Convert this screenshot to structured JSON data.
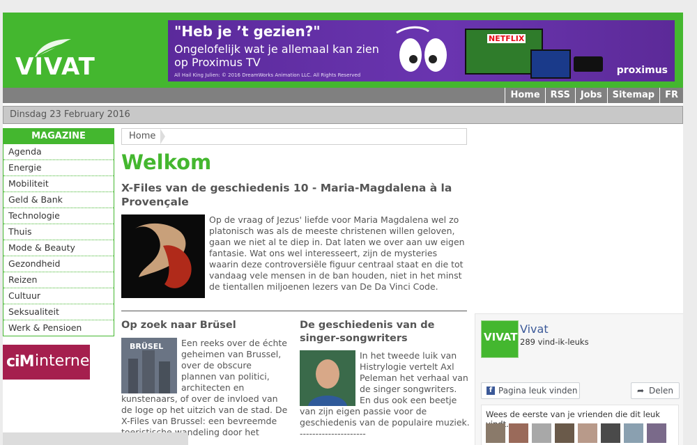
{
  "logo": {
    "text": "VIVAT"
  },
  "banner": {
    "headline": "\"Heb je ’t gezien?\"",
    "line1": "Ongelofelijk wat je allemaal kan zien",
    "line2": "op Proximus TV",
    "credit": "All Hail King Julien: © 2016 DreamWorks Animation LLC. All Rights Reserved",
    "netflix": "NETFLIX",
    "brand": "proximus"
  },
  "nav": {
    "items": [
      "Home",
      "RSS",
      "Jobs",
      "Sitemap",
      "FR"
    ]
  },
  "date": "Dinsdag 23 February 2016",
  "sidebar": {
    "header": "MAGAZINE",
    "items": [
      "Agenda",
      "Energie",
      "Mobiliteit",
      "Geld & Bank",
      "Technologie",
      "Thuis",
      "Mode & Beauty",
      "Gezondheid",
      "Reizen",
      "Cultuur",
      "Seksualiteit",
      "Werk & Pensioen"
    ]
  },
  "cim": {
    "logo": "ciM",
    "word": "internet"
  },
  "breadcrumb": "Home",
  "welcome": "Welkom",
  "article1": {
    "title": "X-Files van de geschiedenis 10 - Maria-Magdalena à la Provençale",
    "text": "Op de vraag of Jezus' liefde voor Maria Magdalena wel zo platonisch was als de meeste christenen willen geloven, gaan we niet al te diep in. Dat laten we over aan uw eigen fantasie. Wat ons wel interesseert, zijn de mysteries waarin deze controversiële figuur centraal staat en die tot vandaag vele mensen in de ban houden, niet in het minst de tientallen miljoenen lezers van De Da Vinci Code."
  },
  "article2": {
    "title": "Op zoek naar Brüsel",
    "text": "Een reeks over de échte geheimen van Brussel, over de obscure plannen van politici, architecten en kunstenaars, of over de invloed van de loge op het uitzich van de stad. De X-Files van Brussel: een bevreemde toeristische wandeling door het mythische"
  },
  "article3": {
    "title": "De geschiedenis van de singer-songwriters",
    "text": "In het tweede luik van Histrylogie vertelt Axl Peleman het verhaal van de singer songwriters. En dus ook een beetje van zijn eigen passie voor de geschiedenis van de populaire muziek. ---------------------"
  },
  "facebook": {
    "page_name": "Vivat",
    "likes": "289 vind-ik-leuks",
    "like_button": "Pagina leuk vinden",
    "share_button": "Delen",
    "friends_text": "Wees de eerste van je vrienden die dit leuk vindt."
  }
}
